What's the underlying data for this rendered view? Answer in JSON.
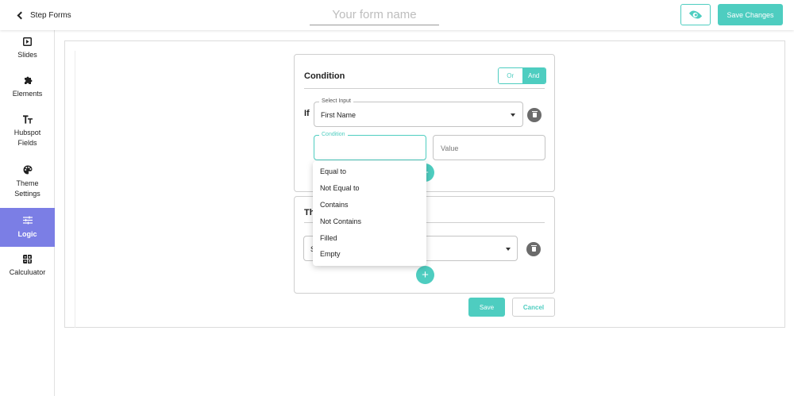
{
  "header": {
    "back_label": "Step Forms",
    "form_name_placeholder": "Your form name",
    "preview_icon": "eye-icon",
    "save_changes_label": "Save Changes"
  },
  "sidebar": {
    "items": [
      {
        "label": "Slides",
        "icon": "play-square-icon"
      },
      {
        "label": "Elements",
        "icon": "puzzle-icon"
      },
      {
        "label": "Hubspot Fields",
        "icon": "text-type-icon"
      },
      {
        "label": "Theme Settings",
        "icon": "palette-icon"
      },
      {
        "label": "Logic",
        "icon": "sliders-icon",
        "active": true
      },
      {
        "label": "Calculuator",
        "icon": "calculator-icon"
      }
    ]
  },
  "condition_card": {
    "title": "Condition",
    "toggle": {
      "or_label": "Or",
      "and_label": "And",
      "selected": "And"
    },
    "if_label": "If",
    "select_input": {
      "legend": "Select Input",
      "value": "First Name"
    },
    "condition_field": {
      "legend": "Condition",
      "value": ""
    },
    "value_field": {
      "placeholder": "Value"
    }
  },
  "then_card": {
    "title": "Then",
    "select_prefix": "S"
  },
  "condition_menu": {
    "options": [
      "Equal to",
      "Not Equal to",
      "Contains",
      "Not Contains",
      "Filled",
      "Empty"
    ]
  },
  "actions": {
    "save_label": "Save",
    "cancel_label": "Cancel"
  },
  "colors": {
    "accent": "#4ecdc0",
    "sidebar_active": "#7b7ee5",
    "delete_button": "#6b6b6b"
  }
}
